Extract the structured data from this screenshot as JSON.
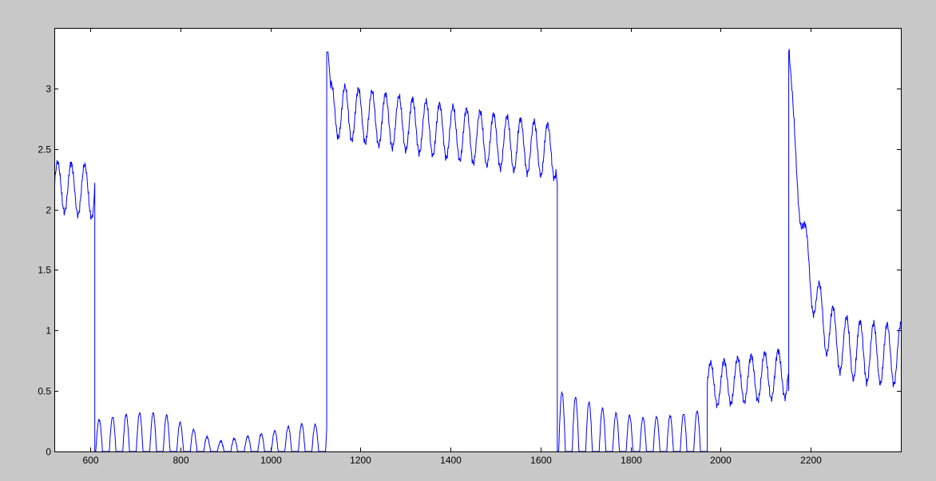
{
  "chart_data": {
    "type": "line",
    "title": "",
    "xlabel": "",
    "ylabel": "",
    "xlim": [
      520,
      2400
    ],
    "ylim": [
      0,
      3.5
    ],
    "x_ticks": [
      600,
      800,
      1000,
      1200,
      1400,
      1600,
      1800,
      2000,
      2200
    ],
    "y_ticks": [
      0,
      0.5,
      1,
      1.5,
      2,
      2.5,
      3
    ],
    "y_tick_labels": [
      "0",
      "0.5",
      "1",
      "1.5",
      "2",
      "2.5",
      "3"
    ],
    "grid": false,
    "legend": "none",
    "series": [
      {
        "color": "#0000ff",
        "segments": [
          {
            "x_start": 520,
            "x_end": 608,
            "type": "oscillation",
            "mean": 2.17,
            "amp_start": 0.2,
            "amp_end": 0.22,
            "trend": -0.05,
            "period": 30
          },
          {
            "x_start": 612,
            "x_end": 1123,
            "type": "rectified",
            "period": 30,
            "amps": [
              [
                612,
                0.26
              ],
              [
                700,
                0.32
              ],
              [
                760,
                0.32
              ],
              [
                830,
                0.18
              ],
              [
                880,
                0.08
              ],
              [
                940,
                0.12
              ],
              [
                1000,
                0.16
              ],
              [
                1060,
                0.23
              ],
              [
                1123,
                0.22
              ]
            ]
          },
          {
            "x_start": 1128,
            "x_end": 1634,
            "type": "oscillation",
            "mean": 2.65,
            "amp_start": 0.22,
            "amp_end": 0.22,
            "trend": -0.35,
            "period": 30,
            "peak_at_start": 3.3
          },
          {
            "x_start": 1640,
            "x_end": 1970,
            "type": "rectified",
            "period": 30,
            "amps": [
              [
                1640,
                0.5
              ],
              [
                1700,
                0.42
              ],
              [
                1760,
                0.32
              ],
              [
                1830,
                0.28
              ],
              [
                1900,
                0.3
              ],
              [
                1970,
                0.35
              ]
            ]
          },
          {
            "x_start": 1970,
            "x_end": 2150,
            "type": "oscillation",
            "mean": 0.6,
            "amp_start": 0.18,
            "amp_end": 0.2,
            "trend": 0.1,
            "period": 30
          },
          {
            "x_start": 2152,
            "x_end": 2400,
            "type": "decay",
            "peak": 3.3,
            "tail_mean": 0.8,
            "amp": 0.25,
            "period": 30
          }
        ],
        "steps": [
          {
            "x": 610,
            "from": 2.22,
            "to": 0
          },
          {
            "x": 1125,
            "from": 0.2,
            "to": 3.3
          },
          {
            "x": 1637,
            "from": 2.2,
            "to": 0
          },
          {
            "x": 2151,
            "from": 0.5,
            "to": 3.3
          }
        ]
      }
    ]
  }
}
